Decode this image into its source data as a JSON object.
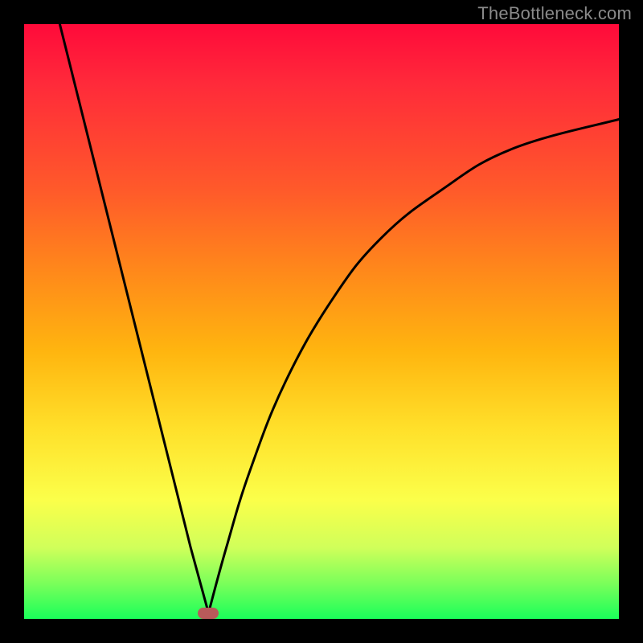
{
  "watermark": "TheBottleneck.com",
  "colors": {
    "frame": "#000000",
    "curve": "#000000",
    "marker": "#b85a5a",
    "gradient_stops": [
      "#ff0a3a",
      "#ff2a3a",
      "#ff5a2a",
      "#ff8a1a",
      "#ffb50f",
      "#ffe02a",
      "#fbff4a",
      "#d0ff5a",
      "#7bff5a",
      "#1aff5a"
    ]
  },
  "chart_data": {
    "type": "line",
    "title": "",
    "xlabel": "",
    "ylabel": "",
    "xlim": [
      0,
      100
    ],
    "ylim": [
      0,
      100
    ],
    "curve_description": "Black line starts near the top-left, falls steeply and nearly linearly to a sharp minimum around x≈31, y≈1, then rises along a concave (decelerating) curve toward the upper-right, ending near y≈84 at x=100.",
    "left_branch": [
      {
        "x": 6,
        "y": 100
      },
      {
        "x": 12,
        "y": 76
      },
      {
        "x": 18,
        "y": 52
      },
      {
        "x": 24,
        "y": 28
      },
      {
        "x": 28,
        "y": 12
      },
      {
        "x": 31,
        "y": 1
      }
    ],
    "right_branch": [
      {
        "x": 31,
        "y": 1
      },
      {
        "x": 34,
        "y": 12
      },
      {
        "x": 38,
        "y": 25
      },
      {
        "x": 44,
        "y": 40
      },
      {
        "x": 52,
        "y": 54
      },
      {
        "x": 60,
        "y": 64
      },
      {
        "x": 70,
        "y": 72
      },
      {
        "x": 82,
        "y": 79
      },
      {
        "x": 100,
        "y": 84
      }
    ],
    "minimum_marker": {
      "x": 31,
      "y": 1
    }
  }
}
